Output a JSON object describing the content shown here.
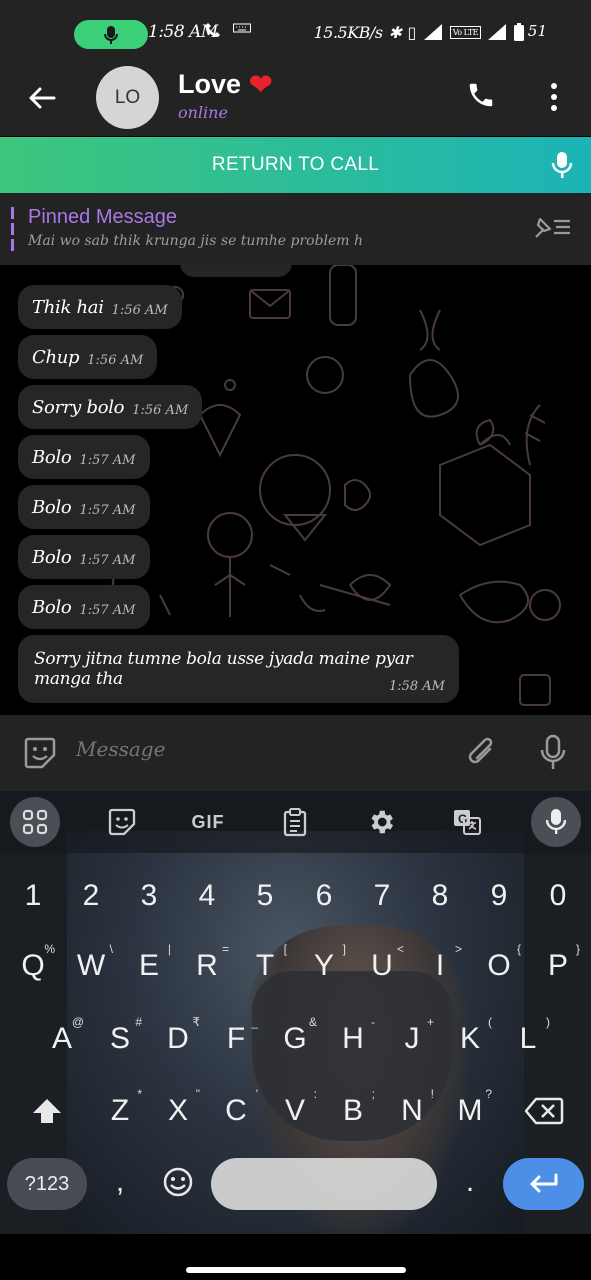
{
  "status_bar": {
    "time": "1:58 AM",
    "speed": "15.5KB/s",
    "battery": "51",
    "volte": "Vo LTE",
    "icons": [
      "mic-icon",
      "call-icon",
      "keyboard-icon",
      "bluetooth-icon",
      "vibrate-icon",
      "signal-icon",
      "battery-icon"
    ]
  },
  "header": {
    "avatar_initials": "LO",
    "name": "Love",
    "name_emoji": "❤",
    "status": "online"
  },
  "call_banner": {
    "label": "RETURN TO CALL"
  },
  "pinned": {
    "title": "Pinned Message",
    "text": "Mai wo sab thik krunga jis se tumhe problem h"
  },
  "messages": [
    {
      "text": "Thik hai",
      "time": "1:56 AM"
    },
    {
      "text": "Chup",
      "time": "1:56 AM"
    },
    {
      "text": "Sorry bolo",
      "time": "1:56 AM"
    },
    {
      "text": "Bolo",
      "time": "1:57 AM"
    },
    {
      "text": "Bolo",
      "time": "1:57 AM"
    },
    {
      "text": "Bolo",
      "time": "1:57 AM"
    },
    {
      "text": "Bolo",
      "time": "1:57 AM"
    },
    {
      "text": "Sorry jitna tumne bola usse jyada maine pyar manga tha",
      "time": "1:58 AM"
    }
  ],
  "composer": {
    "placeholder": "Message"
  },
  "keyboard": {
    "toolbar": {
      "gif": "GIF"
    },
    "row_numbers": [
      "1",
      "2",
      "3",
      "4",
      "5",
      "6",
      "7",
      "8",
      "9",
      "0"
    ],
    "row1": [
      "Q",
      "W",
      "E",
      "R",
      "T",
      "Y",
      "U",
      "I",
      "O",
      "P"
    ],
    "row1_hints": [
      "%",
      "\\",
      "|",
      "=",
      "[",
      "]",
      "<",
      ">",
      "{",
      "}"
    ],
    "row2": [
      "A",
      "S",
      "D",
      "F",
      "G",
      "H",
      "J",
      "K",
      "L"
    ],
    "row2_hints": [
      "@",
      "#",
      "₹",
      "_",
      "&",
      "-",
      "+",
      "(",
      ")"
    ],
    "row3": [
      "Z",
      "X",
      "C",
      "V",
      "B",
      "N",
      "M"
    ],
    "row3_hints": [
      "*",
      "\"",
      "'",
      ":",
      ";",
      "!",
      "?"
    ],
    "symbols_label": "?123",
    "comma": ",",
    "period": "."
  }
}
